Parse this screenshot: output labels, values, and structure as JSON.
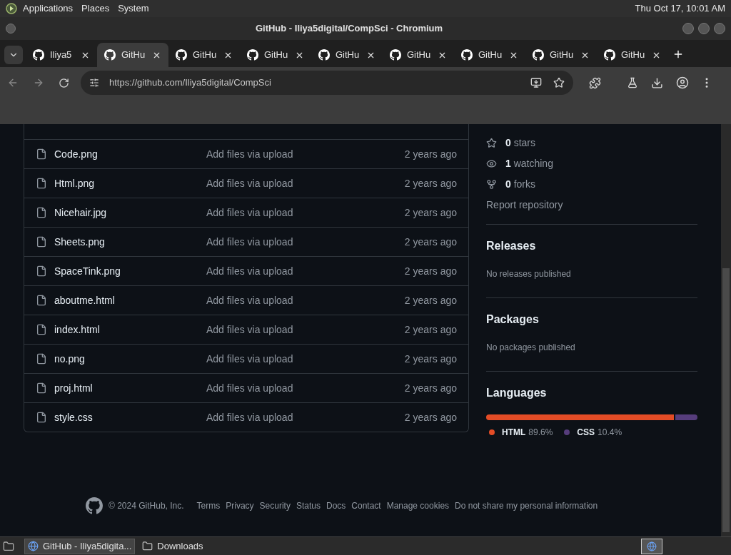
{
  "top_panel": {
    "menus": [
      "Applications",
      "Places",
      "System"
    ],
    "clock": "Thu Oct 17, 10:01 AM"
  },
  "window": {
    "title": "GitHub - Iliya5digital/CompSci - Chromium"
  },
  "tabs": [
    {
      "label": "Iliya5",
      "selected": false
    },
    {
      "label": "GitHu",
      "selected": true
    },
    {
      "label": "GitHu",
      "selected": false
    },
    {
      "label": "GitHu",
      "selected": false
    },
    {
      "label": "GitHu",
      "selected": false
    },
    {
      "label": "GitHu",
      "selected": false
    },
    {
      "label": "GitHu",
      "selected": false
    },
    {
      "label": "GitHu",
      "selected": false
    },
    {
      "label": "GitHu",
      "selected": false
    }
  ],
  "address_bar": {
    "url": "https://github.com/Iliya5digital/CompSci"
  },
  "files": [
    {
      "name": "Code.png",
      "message": "Add files via upload",
      "age": "2 years ago"
    },
    {
      "name": "Html.png",
      "message": "Add files via upload",
      "age": "2 years ago"
    },
    {
      "name": "Nicehair.jpg",
      "message": "Add files via upload",
      "age": "2 years ago"
    },
    {
      "name": "Sheets.png",
      "message": "Add files via upload",
      "age": "2 years ago"
    },
    {
      "name": "SpaceTink.png",
      "message": "Add files via upload",
      "age": "2 years ago"
    },
    {
      "name": "aboutme.html",
      "message": "Add files via upload",
      "age": "2 years ago"
    },
    {
      "name": "index.html",
      "message": "Add files via upload",
      "age": "2 years ago"
    },
    {
      "name": "no.png",
      "message": "Add files via upload",
      "age": "2 years ago"
    },
    {
      "name": "proj.html",
      "message": "Add files via upload",
      "age": "2 years ago"
    },
    {
      "name": "style.css",
      "message": "Add files via upload",
      "age": "2 years ago"
    }
  ],
  "sidebar": {
    "stats": [
      {
        "kind": "stars",
        "count": "0",
        "label": "stars"
      },
      {
        "kind": "watching",
        "count": "1",
        "label": "watching"
      },
      {
        "kind": "forks",
        "count": "0",
        "label": "forks"
      }
    ],
    "report_link": "Report repository",
    "sections": [
      {
        "title": "Releases",
        "text": "No releases published"
      },
      {
        "title": "Packages",
        "text": "No packages published"
      }
    ],
    "languages": {
      "title": "Languages",
      "items": [
        {
          "name": "HTML",
          "percent": "89.6%",
          "color": "#e34c26",
          "level": 0.896
        },
        {
          "name": "CSS",
          "percent": "10.4%",
          "color": "#563d7c",
          "level": 0.104
        }
      ]
    }
  },
  "footer": {
    "copyright": "© 2024 GitHub, Inc.",
    "links": [
      "Terms",
      "Privacy",
      "Security",
      "Status",
      "Docs",
      "Contact",
      "Manage cookies",
      "Do not share my personal information"
    ]
  },
  "taskbar": {
    "items": [
      {
        "kind": "browser",
        "label": "GitHub - Iliya5digita...",
        "selected": true
      },
      {
        "kind": "folder",
        "label": "Downloads",
        "selected": false
      }
    ]
  }
}
